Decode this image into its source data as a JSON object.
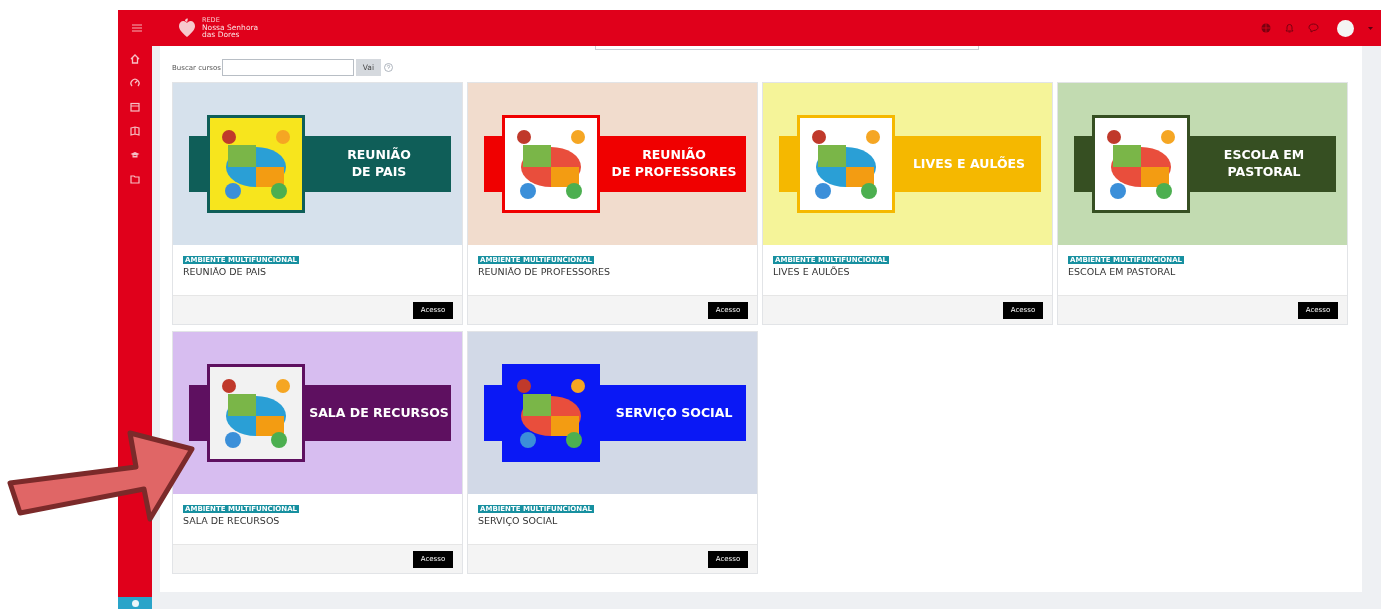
{
  "header": {
    "brand_small": "REDE",
    "brand_lines": [
      "Nossa Senhora",
      "das Dores"
    ]
  },
  "search": {
    "label": "Buscar cursos",
    "button": "Vai"
  },
  "courses": [
    {
      "badge": "AMBIENTE MULTIFUNCIONAL",
      "name": "REUNIÃO DE PAIS",
      "button": "Acesso",
      "banner": {
        "title": [
          "REUNIÃO",
          "DE PAIS"
        ]
      }
    },
    {
      "badge": "AMBIENTE MULTIFUNCIONAL",
      "name": "REUNIÃO DE PROFESSORES",
      "button": "Acesso",
      "banner": {
        "title": [
          "REUNIÃO",
          "DE PROFESSORES"
        ]
      }
    },
    {
      "badge": "AMBIENTE MULTIFUNCIONAL",
      "name": "LIVES E AULÕES",
      "button": "Acesso",
      "banner": {
        "title": [
          "LIVES E AULÕES"
        ]
      }
    },
    {
      "badge": "AMBIENTE MULTIFUNCIONAL",
      "name": "ESCOLA EM PASTORAL",
      "button": "Acesso",
      "banner": {
        "title": [
          "ESCOLA EM",
          "PASTORAL"
        ]
      }
    },
    {
      "badge": "AMBIENTE MULTIFUNCIONAL",
      "name": "SALA DE RECURSOS",
      "button": "Acesso",
      "banner": {
        "title": [
          "SALA DE RECURSOS"
        ]
      }
    },
    {
      "badge": "AMBIENTE MULTIFUNCIONAL",
      "name": "SERVIÇO SOCIAL",
      "button": "Acesso",
      "banner": {
        "title": [
          "SERVIÇO SOCIAL"
        ]
      }
    }
  ]
}
